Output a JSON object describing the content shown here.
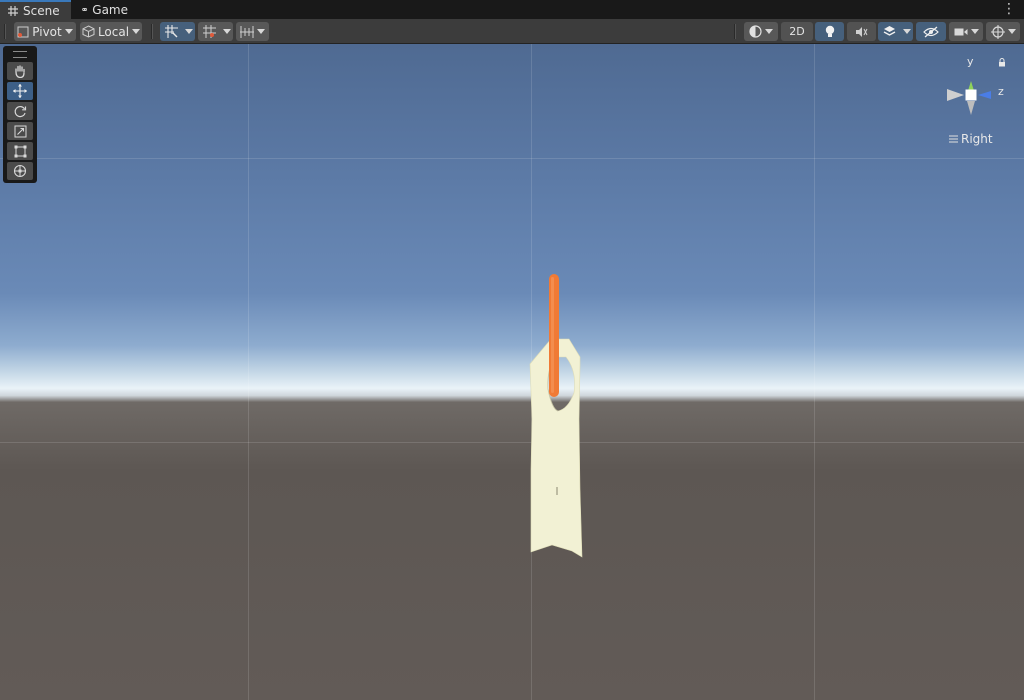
{
  "tabs": [
    {
      "label": "Scene",
      "icon": "grid-icon",
      "active": true
    },
    {
      "label": "Game",
      "icon": "gamepad-icon",
      "active": false
    }
  ],
  "toolbar": {
    "pivot_label": "Pivot",
    "local_label": "Local",
    "mode_2d_label": "2D"
  },
  "scene_tools": [
    "hand-tool",
    "move-tool",
    "rotate-tool",
    "scale-tool",
    "rect-tool",
    "transform-tool"
  ],
  "active_tool": "move-tool",
  "gizmo": {
    "axis_y": "y",
    "axis_z": "z",
    "view_label": "Right",
    "colors": {
      "y": "#8fd35a",
      "z": "#4a7de6",
      "center": "#ffffff"
    }
  },
  "colors": {
    "accent": "#3a79bb",
    "object_body": "#f2f1d4",
    "object_rod": "#f07a35"
  }
}
